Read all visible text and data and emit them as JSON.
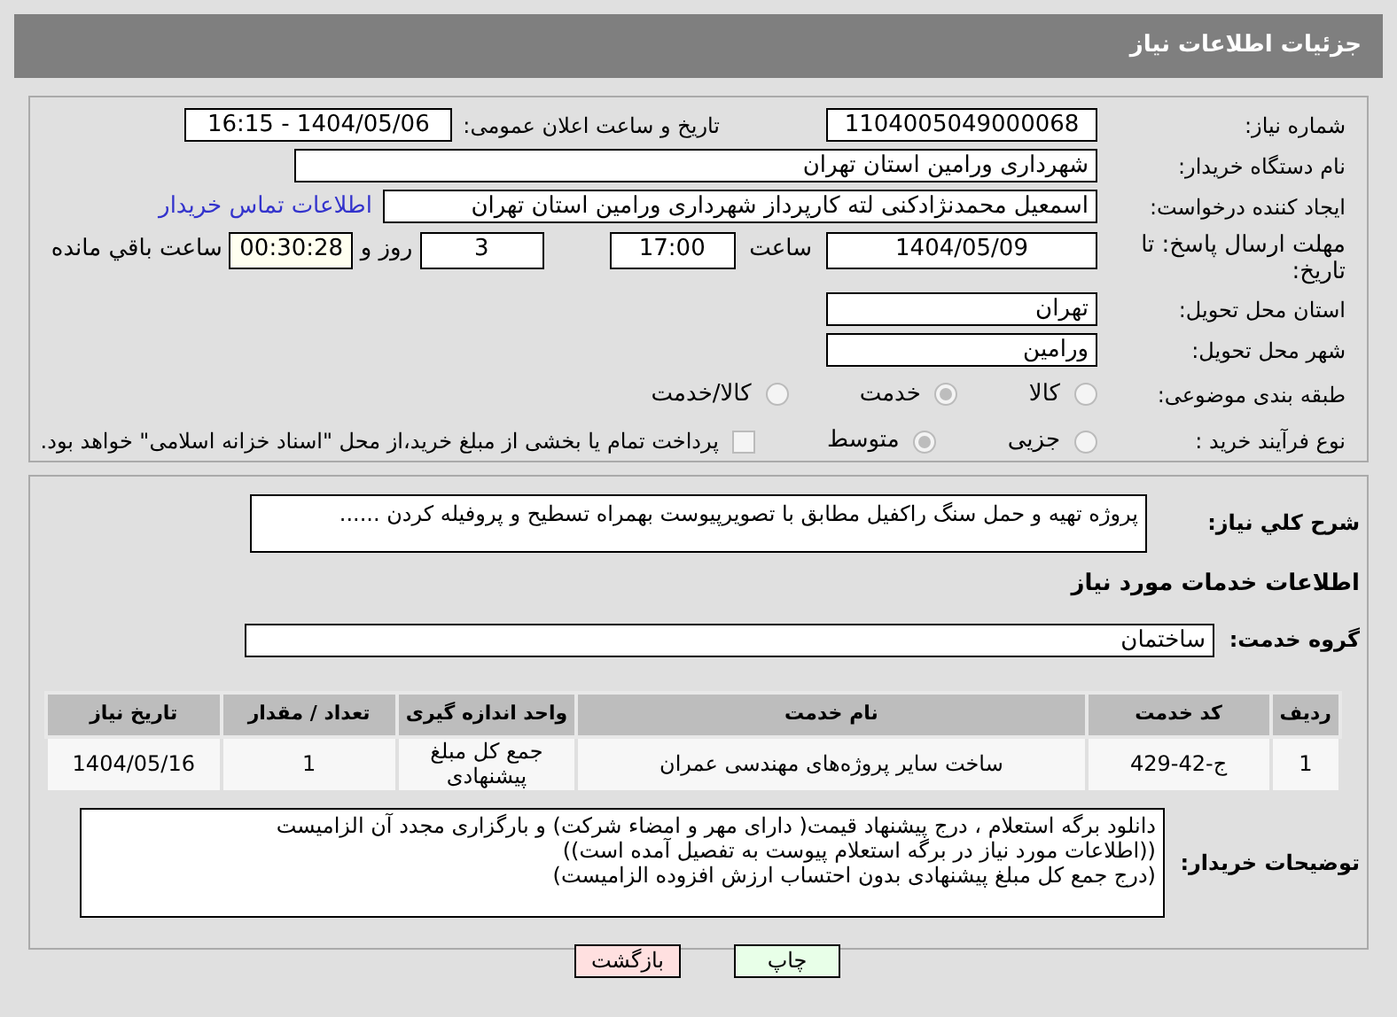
{
  "header": {
    "title": "جزئیات اطلاعات نیاز"
  },
  "fields": {
    "need_number": {
      "label": "شماره نیاز:",
      "value": "1104005049000068"
    },
    "announce": {
      "label": "تاریخ و ساعت اعلان عمومی:",
      "value": "1404/05/06 - 16:15"
    },
    "buyer": {
      "label": "نام دستگاه خریدار:",
      "value": "شهرداری ورامین استان تهران"
    },
    "creator": {
      "label": "ایجاد کننده درخواست:",
      "value": "اسمعیل محمدنژادکنی لته کارپرداز شهرداری ورامین استان تهران",
      "link": "اطلاعات تماس خریدار"
    },
    "deadline": {
      "label": "مهلت ارسال پاسخ: تا تاریخ:",
      "date": "1404/05/09",
      "time_label": "ساعت",
      "time": "17:00",
      "days": "3",
      "days_label": "روز و",
      "remaining": "00:30:28",
      "remaining_label": "ساعت باقي مانده"
    },
    "province": {
      "label": "استان محل تحویل:",
      "value": "تهران"
    },
    "city": {
      "label": "شهر محل تحویل:",
      "value": "ورامین"
    }
  },
  "category": {
    "label": "طبقه بندی موضوعی:",
    "options": [
      {
        "label": "کالا",
        "selected": false
      },
      {
        "label": "خدمت",
        "selected": true
      },
      {
        "label": "کالا/خدمت",
        "selected": false
      }
    ]
  },
  "process": {
    "label": "نوع فرآیند خرید :",
    "options": [
      {
        "kind": "radio",
        "label": "جزیی",
        "selected": false
      },
      {
        "kind": "radio",
        "label": "متوسط",
        "selected": true
      },
      {
        "kind": "checkbox",
        "label": "پرداخت تمام یا بخشی از مبلغ خرید،از محل \"اسناد خزانه اسلامی\" خواهد بود.",
        "checked": false
      }
    ]
  },
  "description": {
    "label": "شرح کلي نياز:",
    "value": "پروژه تهیه و حمل سنگ راکفیل مطابق با تصویرپیوست بهمراه تسطیح و پروفیله کردن ......"
  },
  "services_heading": "اطلاعات خدمات مورد نیاز",
  "service_group": {
    "label": "گروه خدمت:",
    "value": "ساختمان"
  },
  "table": {
    "columns": [
      "ردیف",
      "کد خدمت",
      "نام خدمت",
      "واحد اندازه گیری",
      "تعداد / مقدار",
      "تاریخ نیاز"
    ],
    "rows": [
      [
        "1",
        "ج-42-429",
        "ساخت سایر پروژه‌های مهندسی عمران",
        "جمع کل مبلغ پیشنهادی",
        "1",
        "1404/05/16"
      ]
    ]
  },
  "buyer_notes": {
    "label": "توضیحات خریدار:",
    "lines": [
      "دانلود برگه استعلام ، درج پیشنهاد قیمت( دارای مهر و امضاء شرکت) و بارگزاری مجدد آن الزامیست",
      "((اطلاعات مورد نیاز در برگه استعلام پیوست به تفصیل آمده است))",
      "(درج  جمع کل مبلغ پیشنهادی بدون احتساب ارزش افزوده الزامیست)"
    ]
  },
  "buttons": [
    {
      "kind": "print",
      "label": "چاپ"
    },
    {
      "kind": "back",
      "label": "بازگشت"
    }
  ]
}
